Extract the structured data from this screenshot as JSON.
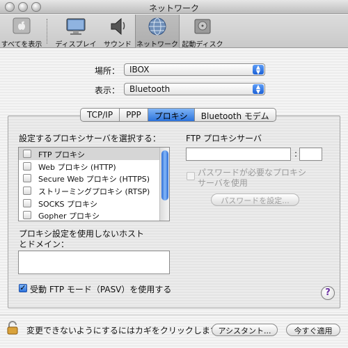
{
  "window": {
    "title": "ネットワーク"
  },
  "toolbar": {
    "items": [
      {
        "label": "すべてを表示",
        "icon": "apple-icon"
      },
      {
        "label": "ディスプレイ",
        "icon": "display-icon"
      },
      {
        "label": "サウンド",
        "icon": "speaker-icon"
      },
      {
        "label": "ネットワーク",
        "icon": "globe-icon",
        "active": true
      },
      {
        "label": "起動ディスク",
        "icon": "disk-icon"
      }
    ]
  },
  "location": {
    "label": "場所：",
    "value": "IBOX"
  },
  "show": {
    "label": "表示：",
    "value": "Bluetooth"
  },
  "tabs": [
    "TCP/IP",
    "PPP",
    "プロキシ",
    "Bluetooth モデム"
  ],
  "proxies": {
    "select_label": "設定するプロキシサーバを選択する：",
    "items": [
      "FTP プロキシ",
      "Web プロキシ (HTTP)",
      "Secure Web プロキシ (HTTPS)",
      "ストリーミングプロキシ (RTSP)",
      "SOCKS プロキシ",
      "Gopher プロキシ"
    ],
    "server_label": "FTP プロキシサーバ",
    "port_separator": ":",
    "password_required_label_1": "パスワードが必要なプロキシ",
    "password_required_label_2": "サーバを使用",
    "set_password_button": "パスワードを設定...",
    "bypass_label_1": "プロキシ設定を使用しないホスト",
    "bypass_label_2": "とドメイン：",
    "pasv_label": "受動 FTP モード（PASV）を使用する"
  },
  "help": {
    "glyph": "?"
  },
  "footer": {
    "lock_text": "変更できないようにするにはカギをクリックします。",
    "assistant_button": "アシスタント...",
    "apply_button": "今すぐ適用"
  }
}
